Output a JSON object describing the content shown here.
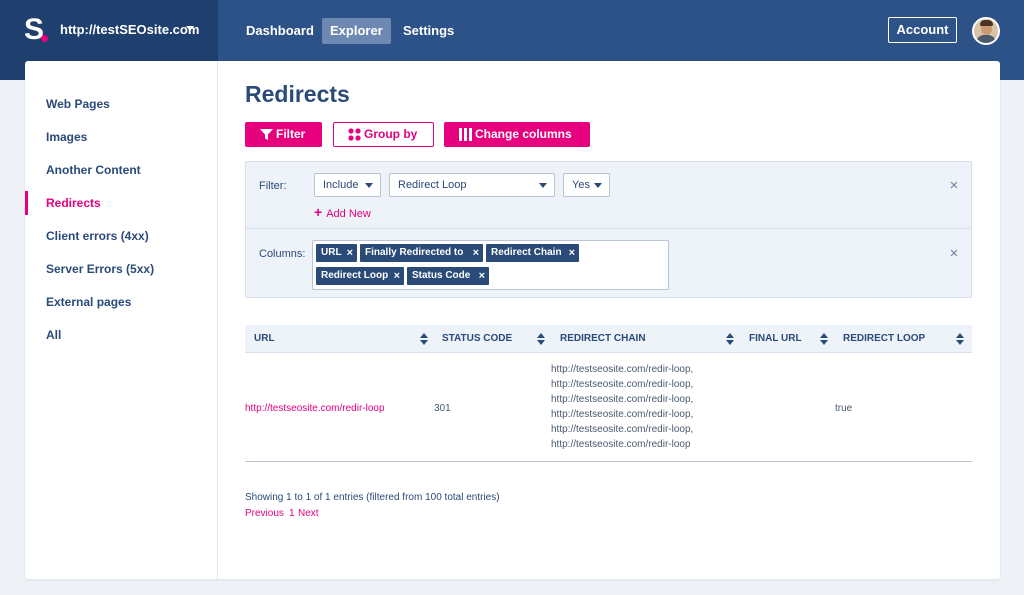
{
  "header": {
    "site": "http://testSEOsite.com",
    "nav": [
      "Dashboard",
      "Explorer",
      "Settings"
    ],
    "account": "Account",
    "logo": "S"
  },
  "sidebar": {
    "items": [
      {
        "label": "Web Pages"
      },
      {
        "label": "Images"
      },
      {
        "label": "Another Content"
      },
      {
        "label": "Redirects"
      },
      {
        "label": "Client errors (4xx)"
      },
      {
        "label": "Server Errors (5xx)"
      },
      {
        "label": "External pages"
      },
      {
        "label": "All"
      }
    ],
    "active_index": 3
  },
  "main": {
    "title": "Redirects",
    "buttons": {
      "filter": "Filter",
      "group_by": "Group by",
      "change_columns": "Change columns"
    },
    "filter": {
      "label": "Filter:",
      "mode": "Include",
      "field": "Redirect Loop",
      "value": "Yes",
      "add_new": "Add New"
    },
    "columns": {
      "label": "Columns:",
      "tags": [
        "URL",
        "Finally Redirected to",
        "Redirect Chain",
        "Redirect Loop",
        "Status Code"
      ]
    },
    "table": {
      "headers": [
        "URL",
        "STATUS CODE",
        "REDIRECT CHAIN",
        "FINAL URL",
        "REDIRECT LOOP"
      ],
      "rows": [
        {
          "url": "http://testseosite.com/redir-loop",
          "status": "301",
          "chain": [
            "http://testseosite.com/redir-loop,",
            "http://testseosite.com/redir-loop,",
            "http://testseosite.com/redir-loop,",
            "http://testseosite.com/redir-loop,",
            "http://testseosite.com/redir-loop,",
            "http://testseosite.com/redir-loop"
          ],
          "final_url": "",
          "loop": "true"
        }
      ]
    },
    "info": "Showing 1 to 1 of 1 entries (filtered from 100 total entries)",
    "pagination": {
      "previous": "Previous",
      "page": "1",
      "next": "Next"
    }
  },
  "colors": {
    "accent": "#e6007e",
    "header": "#2d5288",
    "brand": "#1f3f6e",
    "text": "#2a4a78"
  }
}
